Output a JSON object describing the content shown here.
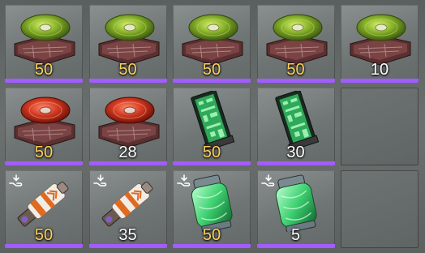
{
  "inventory": {
    "slots": [
      {
        "icon": "green-disc-console-icon",
        "count": "50",
        "count_color": "#ffcf5a",
        "badge": false
      },
      {
        "icon": "green-disc-console-icon",
        "count": "50",
        "count_color": "#ffcf5a",
        "badge": false
      },
      {
        "icon": "green-disc-console-icon",
        "count": "50",
        "count_color": "#ffcf5a",
        "badge": false
      },
      {
        "icon": "green-disc-console-icon",
        "count": "50",
        "count_color": "#ffcf5a",
        "badge": false
      },
      {
        "icon": "green-disc-console-icon",
        "count": "10",
        "count_color": "#ffffff",
        "badge": false
      },
      {
        "icon": "red-disc-console-icon",
        "count": "50",
        "count_color": "#ffcf5a",
        "badge": false
      },
      {
        "icon": "red-disc-console-icon",
        "count": "28",
        "count_color": "#ffffff",
        "badge": false
      },
      {
        "icon": "circuit-module-icon",
        "count": "50",
        "count_color": "#ffcf5a",
        "badge": false
      },
      {
        "icon": "circuit-module-icon",
        "count": "30",
        "count_color": "#ffffff",
        "badge": false
      },
      {
        "icon": "empty-slot",
        "count": "",
        "count_color": "",
        "badge": false
      },
      {
        "icon": "orange-canister-icon",
        "count": "50",
        "count_color": "#ffcf5a",
        "badge": true
      },
      {
        "icon": "orange-canister-icon",
        "count": "35",
        "count_color": "#ffffff",
        "badge": true
      },
      {
        "icon": "green-capsule-icon",
        "count": "50",
        "count_color": "#ffcf5a",
        "badge": true
      },
      {
        "icon": "green-capsule-icon",
        "count": "5",
        "count_color": "#ffffff",
        "badge": true
      },
      {
        "icon": "empty-slot",
        "count": "",
        "count_color": "",
        "badge": false
      }
    ],
    "rarity_bar_color": "#a35cff",
    "badge_icon": "hand-receive-icon"
  }
}
